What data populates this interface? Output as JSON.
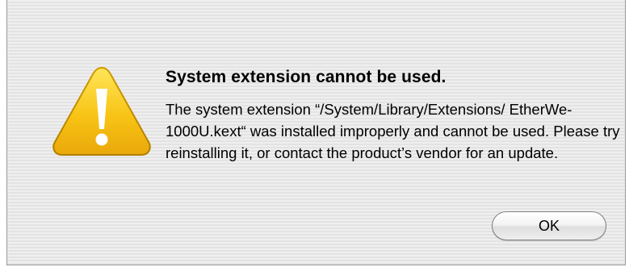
{
  "dialog": {
    "title": "System extension cannot be used.",
    "message": "The system extension “/System/Library/Extensions/ EtherWe-1000U.kext“ was installed improperly and cannot be used. Please try reinstalling it, or contact the product’s vendor for an update.",
    "icon": "warning-icon",
    "ok_label": "OK"
  },
  "colors": {
    "background": "#ececec",
    "warning_yellow": "#f7c21a",
    "warning_mark": "#ffffff"
  }
}
